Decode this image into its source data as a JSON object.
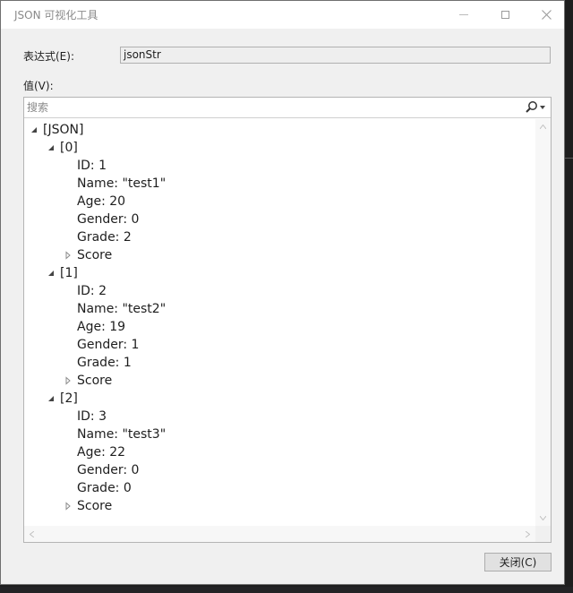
{
  "window": {
    "title": "JSON 可视化工具"
  },
  "form": {
    "expression_label": "表达式(E):",
    "expression_value": "jsonStr",
    "value_label": "值(V):"
  },
  "search": {
    "placeholder": "搜索"
  },
  "tree": [
    {
      "label": "[JSON]",
      "level": 0,
      "toggle": "expanded"
    },
    {
      "label": "[0]",
      "level": 1,
      "toggle": "expanded"
    },
    {
      "label": "ID: 1",
      "level": 2,
      "toggle": "none"
    },
    {
      "label": "Name: \"test1\"",
      "level": 2,
      "toggle": "none"
    },
    {
      "label": "Age: 20",
      "level": 2,
      "toggle": "none"
    },
    {
      "label": "Gender: 0",
      "level": 2,
      "toggle": "none"
    },
    {
      "label": "Grade: 2",
      "level": 2,
      "toggle": "none"
    },
    {
      "label": "Score",
      "level": 2,
      "toggle": "collapsed"
    },
    {
      "label": "[1]",
      "level": 1,
      "toggle": "expanded"
    },
    {
      "label": "ID: 2",
      "level": 2,
      "toggle": "none"
    },
    {
      "label": "Name: \"test2\"",
      "level": 2,
      "toggle": "none"
    },
    {
      "label": "Age: 19",
      "level": 2,
      "toggle": "none"
    },
    {
      "label": "Gender: 1",
      "level": 2,
      "toggle": "none"
    },
    {
      "label": "Grade: 1",
      "level": 2,
      "toggle": "none"
    },
    {
      "label": "Score",
      "level": 2,
      "toggle": "collapsed"
    },
    {
      "label": "[2]",
      "level": 1,
      "toggle": "expanded"
    },
    {
      "label": "ID: 3",
      "level": 2,
      "toggle": "none"
    },
    {
      "label": "Name: \"test3\"",
      "level": 2,
      "toggle": "none"
    },
    {
      "label": "Age: 22",
      "level": 2,
      "toggle": "none"
    },
    {
      "label": "Gender: 0",
      "level": 2,
      "toggle": "none"
    },
    {
      "label": "Grade: 0",
      "level": 2,
      "toggle": "none"
    },
    {
      "label": "Score",
      "level": 2,
      "toggle": "collapsed"
    }
  ],
  "buttons": {
    "close_label": "关闭(C)"
  },
  "icons": {
    "search": "search-icon",
    "expanded": "expanded-triangle-icon",
    "collapsed": "collapsed-triangle-icon"
  }
}
